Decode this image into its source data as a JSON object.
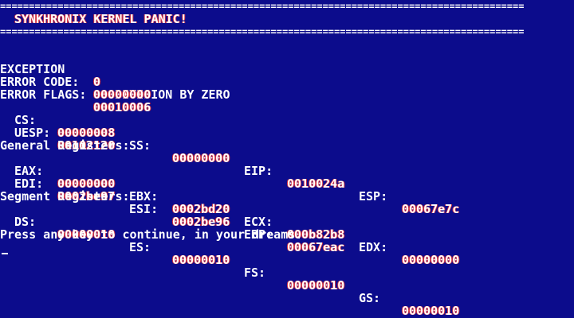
{
  "header": {
    "rule": "===========================================================================================",
    "title": "SYNKHRONIX KERNEL PANIC!"
  },
  "exception": {
    "label": "EXCEPTION",
    "number": "0",
    "message": ": DIVISION BY ZERO"
  },
  "error_code": {
    "label": "ERROR CODE:",
    "value": "00000000"
  },
  "error_flags": {
    "label": "ERROR FLAGS:",
    "value": "00010006"
  },
  "pointers": {
    "cs": {
      "label": "CS:",
      "value": "00000008"
    },
    "ss": {
      "label": "SS:",
      "value": "00000000"
    },
    "eip": {
      "label": "EIP:",
      "value": "0010024a"
    },
    "esp": {
      "label": "ESP:",
      "value": "00067e7c"
    },
    "uesp": {
      "label": "UESP:",
      "value": "00102120"
    }
  },
  "general_registers": {
    "heading": "General Registers:",
    "eax": {
      "label": "EAX:",
      "value": "00000000"
    },
    "ebx": {
      "label": "EBX:",
      "value": "0002bd20"
    },
    "ecx": {
      "label": "ECX:",
      "value": "000b82b8"
    },
    "edx": {
      "label": "EDX:",
      "value": "00000000"
    },
    "edi": {
      "label": "EDI:",
      "value": "0002be97"
    },
    "esi": {
      "label": "ESI:",
      "value": "0002be96"
    },
    "ebp": {
      "label": "EBP:",
      "value": "00067eac"
    }
  },
  "segment_registers": {
    "heading": "Segment Registers:",
    "ds": {
      "label": "DS:",
      "value": "00000010"
    },
    "es": {
      "label": "ES:",
      "value": "00000010"
    },
    "fs": {
      "label": "FS:",
      "value": "00000010"
    },
    "gs": {
      "label": "GS:",
      "value": "00000010"
    }
  },
  "prompt": "Press any key to continue, in your dreams.",
  "colors": {
    "background": "#0c0c8c",
    "text": "#ffffff",
    "value_edge": "#d03040"
  }
}
